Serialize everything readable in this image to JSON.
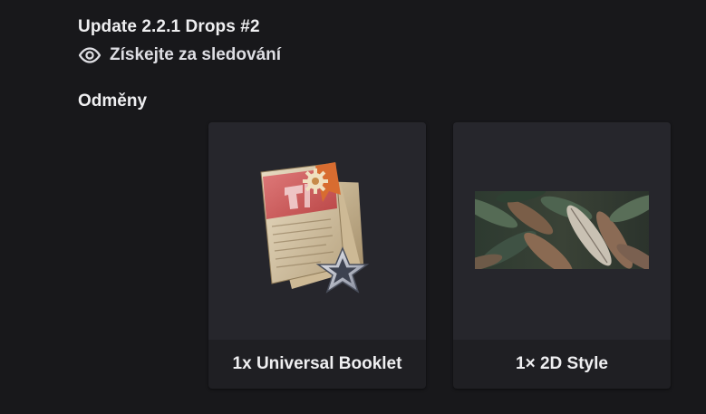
{
  "drop": {
    "title": "Update 2.2.1 Drops #2",
    "watch_label": "Získejte za sledování"
  },
  "rewards": {
    "heading": "Odměny",
    "items": [
      {
        "caption": "1x Universal Booklet",
        "icon": "universal-booklet-icon"
      },
      {
        "caption": "1× 2D Style",
        "icon": "2d-style-feathers-image"
      }
    ]
  },
  "colors": {
    "background": "#18181b",
    "card": "#1f1f23",
    "thumb": "#26262c",
    "text": "#efeff1"
  }
}
